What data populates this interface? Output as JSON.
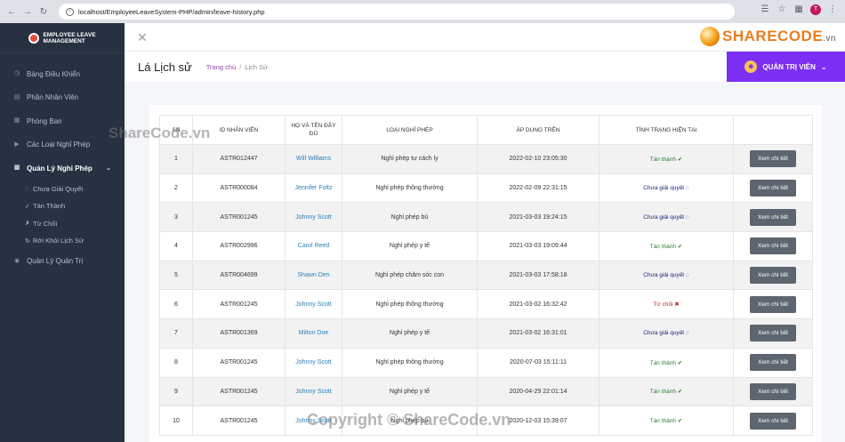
{
  "browser": {
    "url": "localhost/EmployeeLeaveSystem-PHP/admin/leave-history.php",
    "profile_initial": "T"
  },
  "sidebar": {
    "logo_line1": "Employee Leave",
    "logo_line2": "Management",
    "items": [
      {
        "label": "Bảng Điều Khiển",
        "icon": "dashboard-icon"
      },
      {
        "label": "Phần Nhân Viên",
        "icon": "users-icon"
      },
      {
        "label": "Phòng Ban",
        "icon": "grid-icon"
      },
      {
        "label": "Các Loại Nghỉ Phép",
        "icon": "tag-icon"
      },
      {
        "label": "Quản Lý Nghỉ Phép",
        "icon": "briefcase-icon",
        "active": true
      }
    ],
    "submenu": [
      {
        "label": "Chưa Giải Quyết",
        "icon": "spinner-icon"
      },
      {
        "label": "Tán Thành",
        "icon": "check-icon"
      },
      {
        "label": "Từ Chối",
        "icon": "close-icon"
      },
      {
        "label": "Rời Khỏi Lịch Sử",
        "icon": "history-icon"
      }
    ],
    "admin_item": {
      "label": "Quản Lý Quản Trị",
      "icon": "lock-icon"
    }
  },
  "topbar": {
    "brand": "SHARECODE",
    "brand_suffix": ".vn"
  },
  "page": {
    "title": "Lá Lịch sử",
    "breadcrumb_home": "Trang chủ",
    "breadcrumb_sep": "/",
    "breadcrumb_current": "Lịch Sử",
    "admin_label": "QUẢN TRỊ VIÊN"
  },
  "table": {
    "headers": [
      "SN",
      "ID NHÂN VIÊN",
      "HỌ VÀ TÊN ĐẦY ĐỦ",
      "LOẠI NGHỈ PHÉP",
      "ÁP DỤNG TRÊN",
      "TÌNH TRẠNG HIỆN TẠI",
      ""
    ],
    "view_label": "Xem chi tiết",
    "rows": [
      {
        "sn": "1",
        "id": "ASTR012447",
        "name": "Will Williams",
        "type": "Nghỉ phép tự cách ly",
        "date": "2022-02-10 23:05:30",
        "status": "Tán thành",
        "status_kind": "approved"
      },
      {
        "sn": "2",
        "id": "ASTR000084",
        "name": "Jennifer Foltz",
        "type": "Nghỉ phép thông thường",
        "date": "2022-02-09 22:31:15",
        "status": "Chưa giải quyết",
        "status_kind": "pending"
      },
      {
        "sn": "3",
        "id": "ASTR001245",
        "name": "Johnny Scott",
        "type": "Nghỉ phép bù",
        "date": "2021-03-03 19:24:15",
        "status": "Chưa giải quyết",
        "status_kind": "pending"
      },
      {
        "sn": "4",
        "id": "ASTR002996",
        "name": "Carol Reed",
        "type": "Nghỉ phép y tế",
        "date": "2021-03-03 19:09:44",
        "status": "Tán thành",
        "status_kind": "approved"
      },
      {
        "sn": "5",
        "id": "ASTR004699",
        "name": "Shawn Den",
        "type": "Nghỉ phép chăm sóc con",
        "date": "2021-03-03 17:58:18",
        "status": "Chưa giải quyết",
        "status_kind": "pending"
      },
      {
        "sn": "6",
        "id": "ASTR001245",
        "name": "Johnny Scott",
        "type": "Nghỉ phép thông thường",
        "date": "2021-03-02 16:32:42",
        "status": "Từ chối",
        "status_kind": "rejected"
      },
      {
        "sn": "7",
        "id": "ASTR001369",
        "name": "Milton Doe",
        "type": "Nghỉ phép y tế",
        "date": "2021-03-02 16:31:01",
        "status": "Chưa giải quyết",
        "status_kind": "pending"
      },
      {
        "sn": "8",
        "id": "ASTR001245",
        "name": "Johnny Scott",
        "type": "Nghỉ phép thông thường",
        "date": "2020-07-03 15:11:11",
        "status": "Tán thành",
        "status_kind": "approved"
      },
      {
        "sn": "9",
        "id": "ASTR001245",
        "name": "Johnny Scott",
        "type": "Nghỉ phép y tế",
        "date": "2020-04-29 22:01:14",
        "status": "Tán thành",
        "status_kind": "approved"
      },
      {
        "sn": "10",
        "id": "ASTR001245",
        "name": "Johnny Scott",
        "type": "Nghỉ phép bù",
        "date": "2020-12-03 15:39:07",
        "status": "Tán thành",
        "status_kind": "approved"
      }
    ]
  },
  "watermarks": {
    "top": "ShareCode.vn",
    "bottom": "Copyright © ShareCode.vn"
  },
  "colors": {
    "sidebar_bg": "#273142",
    "accent": "#7b2ff2",
    "link": "#2980b9",
    "approved": "#2e7d32",
    "pending": "#1a237e",
    "rejected": "#c62828",
    "button": "#5d6670"
  }
}
